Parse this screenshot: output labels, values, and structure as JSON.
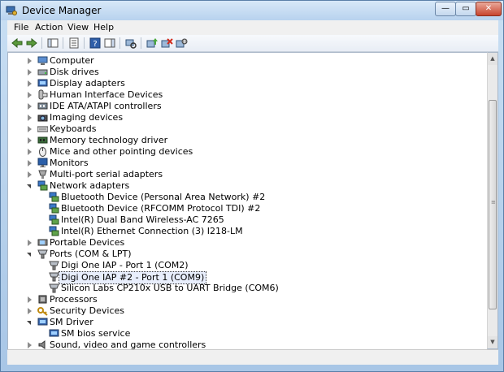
{
  "window": {
    "title": "Device Manager"
  },
  "window_controls": {
    "minimize": "—",
    "maximize": "▭",
    "close": "✕"
  },
  "menu": [
    {
      "label": "File"
    },
    {
      "label": "Action"
    },
    {
      "label": "View"
    },
    {
      "label": "Help"
    }
  ],
  "toolbar": [
    "back-icon",
    "forward-icon",
    "console-tree-icon",
    "properties-icon",
    "help-icon",
    "action-pane-icon",
    "scan-hardware-icon",
    "update-driver-icon",
    "uninstall-icon",
    "disable-icon"
  ],
  "tree": [
    {
      "label": "Computer",
      "level": 0,
      "state": "closed",
      "icon": "computer-icon"
    },
    {
      "label": "Disk drives",
      "level": 0,
      "state": "closed",
      "icon": "disk-drive-icon"
    },
    {
      "label": "Display adapters",
      "level": 0,
      "state": "closed",
      "icon": "display-adapter-icon"
    },
    {
      "label": "Human Interface Devices",
      "level": 0,
      "state": "closed",
      "icon": "hid-icon"
    },
    {
      "label": "IDE ATA/ATAPI controllers",
      "level": 0,
      "state": "closed",
      "icon": "ide-controller-icon"
    },
    {
      "label": "Imaging devices",
      "level": 0,
      "state": "closed",
      "icon": "camera-icon"
    },
    {
      "label": "Keyboards",
      "level": 0,
      "state": "closed",
      "icon": "keyboard-icon"
    },
    {
      "label": "Memory technology driver",
      "level": 0,
      "state": "closed",
      "icon": "memory-icon"
    },
    {
      "label": "Mice and other pointing devices",
      "level": 0,
      "state": "closed",
      "icon": "mouse-icon"
    },
    {
      "label": "Monitors",
      "level": 0,
      "state": "closed",
      "icon": "monitor-icon"
    },
    {
      "label": "Multi-port serial adapters",
      "level": 0,
      "state": "closed",
      "icon": "serial-adapter-icon"
    },
    {
      "label": "Network adapters",
      "level": 0,
      "state": "open",
      "icon": "network-adapter-icon"
    },
    {
      "label": "Bluetooth Device (Personal Area Network) #2",
      "level": 1,
      "state": "none",
      "icon": "network-adapter-icon"
    },
    {
      "label": "Bluetooth Device (RFCOMM Protocol TDI) #2",
      "level": 1,
      "state": "none",
      "icon": "network-adapter-icon"
    },
    {
      "label": "Intel(R) Dual Band Wireless-AC 7265",
      "level": 1,
      "state": "none",
      "icon": "network-adapter-icon"
    },
    {
      "label": "Intel(R) Ethernet Connection (3) I218-LM",
      "level": 1,
      "state": "none",
      "icon": "network-adapter-icon"
    },
    {
      "label": "Portable Devices",
      "level": 0,
      "state": "closed",
      "icon": "portable-device-icon"
    },
    {
      "label": "Ports (COM & LPT)",
      "level": 0,
      "state": "open",
      "icon": "port-icon"
    },
    {
      "label": "Digi One IAP - Port 1 (COM2)",
      "level": 1,
      "state": "none",
      "icon": "port-icon"
    },
    {
      "label": "Digi One IAP #2 - Port 1 (COM9)",
      "level": 1,
      "state": "none",
      "icon": "port-icon",
      "selected": true
    },
    {
      "label": "Silicon Labs CP210x USB to UART Bridge (COM6)",
      "level": 1,
      "state": "none",
      "icon": "port-icon"
    },
    {
      "label": "Processors",
      "level": 0,
      "state": "closed",
      "icon": "processor-icon"
    },
    {
      "label": "Security Devices",
      "level": 0,
      "state": "closed",
      "icon": "security-device-icon"
    },
    {
      "label": "SM Driver",
      "level": 0,
      "state": "open",
      "icon": "display-adapter-icon"
    },
    {
      "label": "SM bios service",
      "level": 1,
      "state": "none",
      "icon": "display-adapter-icon"
    },
    {
      "label": "Sound, video and game controllers",
      "level": 0,
      "state": "closed",
      "icon": "sound-icon"
    }
  ],
  "scrollbar": {
    "up": "▲",
    "down": "▼",
    "grip": "≡"
  }
}
